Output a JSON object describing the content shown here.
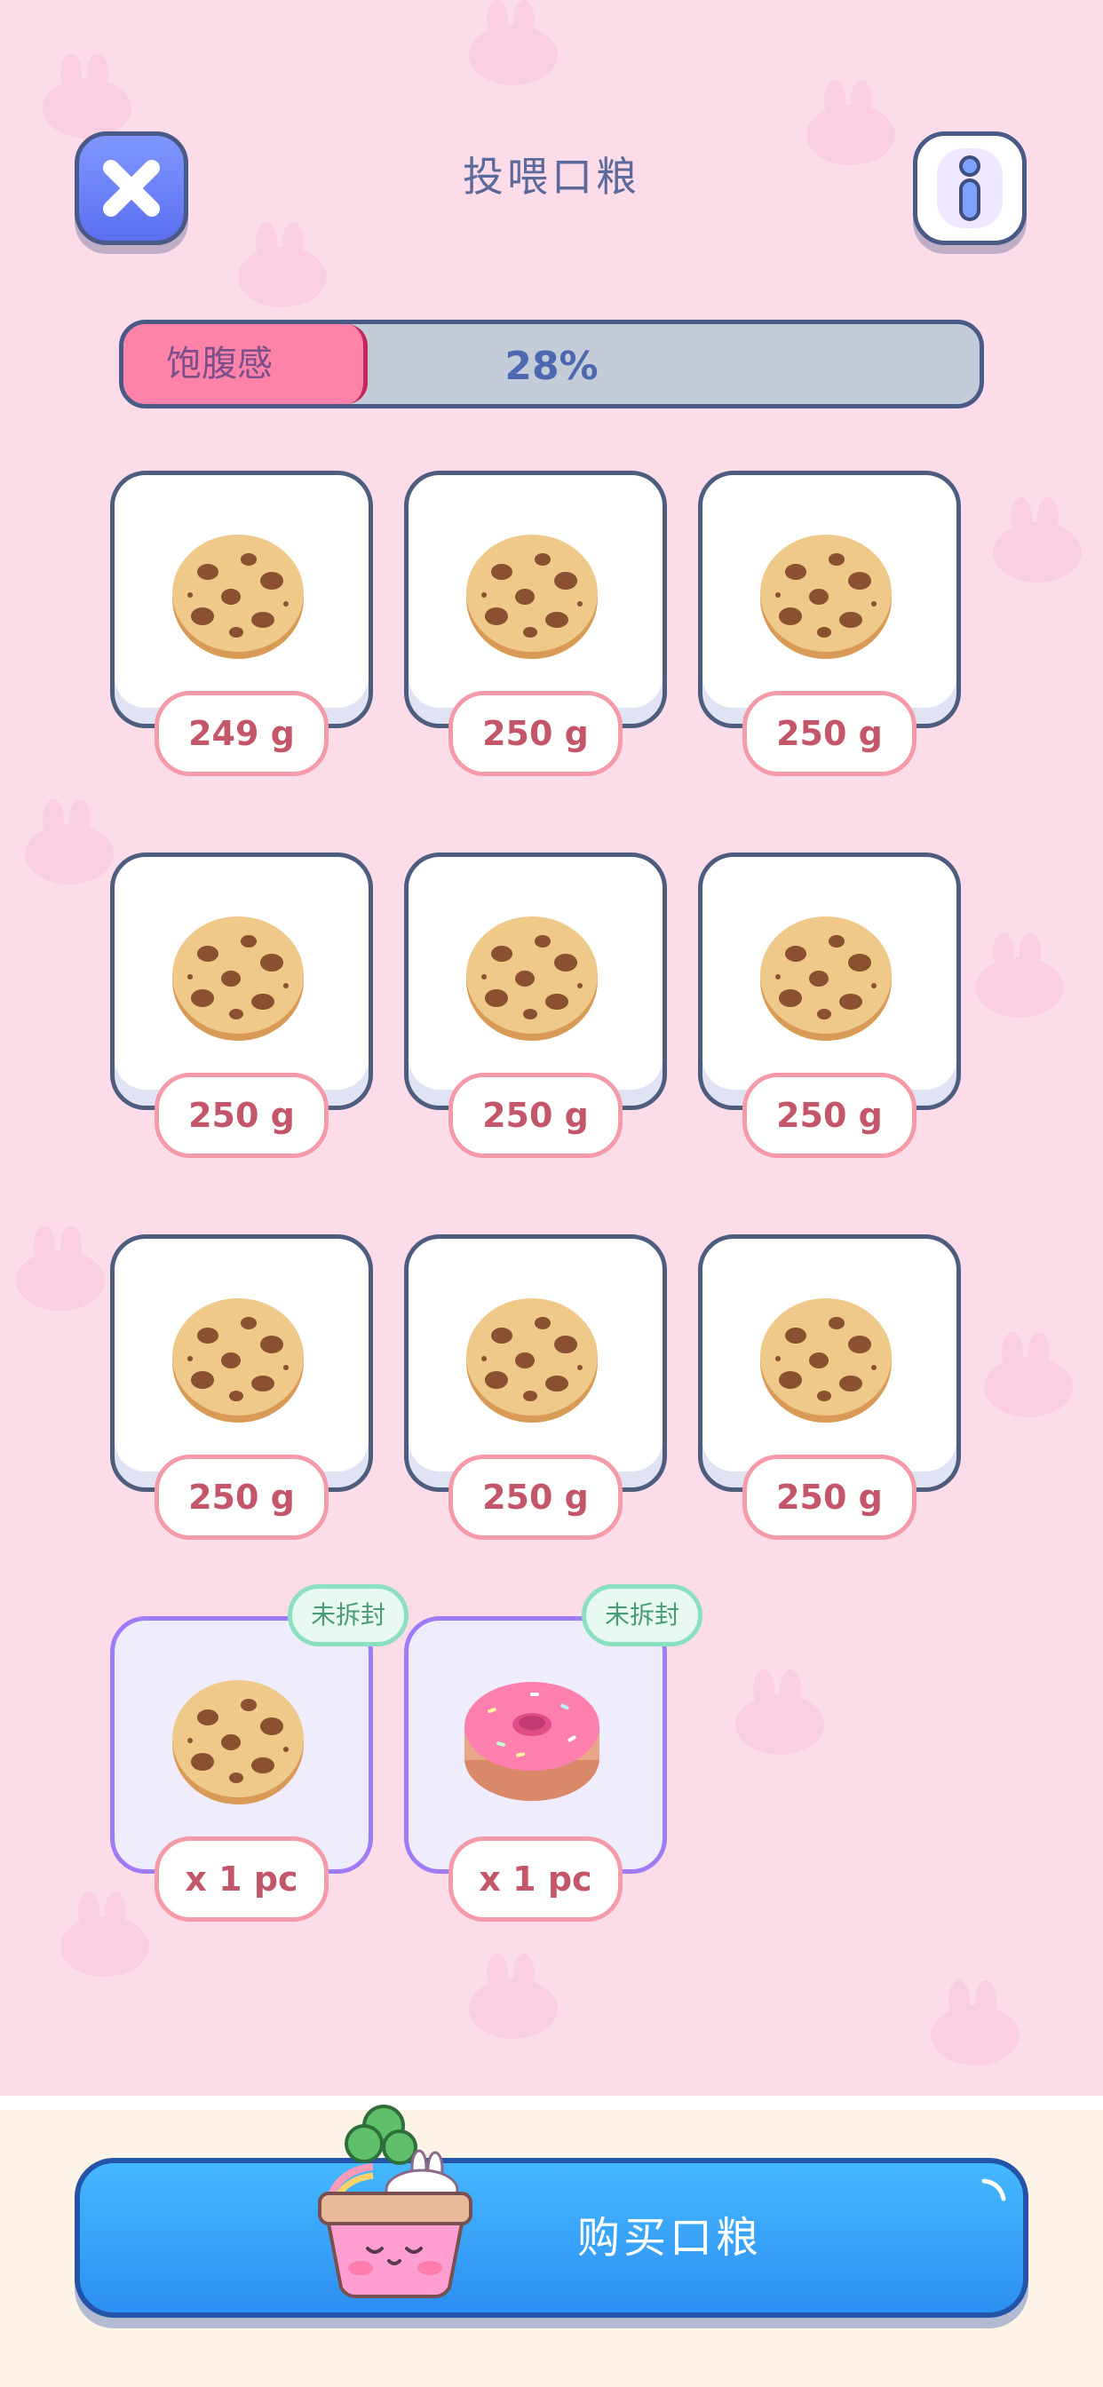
{
  "header": {
    "title": "投喂口粮",
    "close_icon": "close-icon",
    "info_icon": "info-icon"
  },
  "fullness": {
    "label": "饱腹感",
    "percent_text": "28%",
    "value": 0.28
  },
  "food_items": [
    {
      "food": "cookie",
      "qty": "249 g"
    },
    {
      "food": "cookie",
      "qty": "250 g"
    },
    {
      "food": "cookie",
      "qty": "250 g"
    },
    {
      "food": "cookie",
      "qty": "250 g"
    },
    {
      "food": "cookie",
      "qty": "250 g"
    },
    {
      "food": "cookie",
      "qty": "250 g"
    },
    {
      "food": "cookie",
      "qty": "250 g"
    },
    {
      "food": "cookie",
      "qty": "250 g"
    },
    {
      "food": "cookie",
      "qty": "250 g"
    },
    {
      "food": "cookie",
      "qty": "x 1 pc",
      "badge": "未拆封"
    },
    {
      "food": "donut",
      "qty": "x 1 pc",
      "badge": "未拆封"
    }
  ],
  "footer": {
    "buy_label": "购买口粮"
  },
  "colors": {
    "background": "#fddcea",
    "fullness_fill": "#ff83a8",
    "buy_button": "#2c8ff2",
    "sealed_badge": "#8ae0c0"
  }
}
